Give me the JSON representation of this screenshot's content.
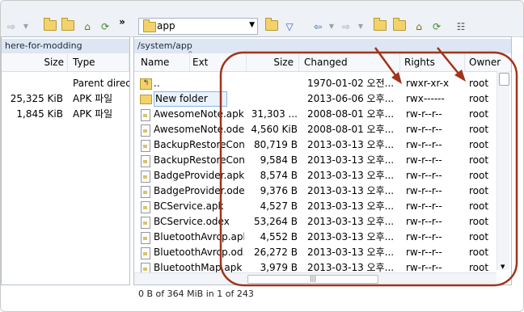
{
  "toolbar": {
    "overflow_label": "»",
    "combo_value": "app"
  },
  "left_panel": {
    "path": "here-for-modding",
    "columns": [
      "Size",
      "Type"
    ],
    "rows": [
      {
        "size": "",
        "type": "Parent direct"
      },
      {
        "size": "25,325 KiB",
        "type": "APK 파일"
      },
      {
        "size": "1,845 KiB",
        "type": "APK 파일"
      }
    ]
  },
  "right_panel": {
    "path": "/system/app",
    "columns": {
      "name": "Name",
      "ext": "Ext",
      "size": "Size",
      "changed": "Changed",
      "rights": "Rights",
      "owner": "Owner"
    },
    "rows": [
      {
        "name": "..",
        "size": "",
        "changed": "1970-01-02 오전...",
        "rights": "rwxr-xr-x",
        "owner": "root",
        "icon": "parent-dir-icon"
      },
      {
        "name": "New folder",
        "size": "",
        "changed": "2013-06-06 오후...",
        "rights": "rwx------",
        "owner": "root",
        "icon": "folder-icon"
      },
      {
        "name": "AwesomeNote.apk",
        "size": "31,303 ...",
        "changed": "2008-08-01 오후...",
        "rights": "rw-r--r--",
        "owner": "root",
        "icon": "file-icon"
      },
      {
        "name": "AwesomeNote.odex",
        "size": "4,560 KiB",
        "changed": "2008-08-01 오후...",
        "rights": "rw-r--r--",
        "owner": "root",
        "icon": "file-icon"
      },
      {
        "name": "BackupRestoreCon...",
        "size": "80,719 B",
        "changed": "2013-03-13 오후...",
        "rights": "rw-r--r--",
        "owner": "root",
        "icon": "file-icon"
      },
      {
        "name": "BackupRestoreCon...",
        "size": "9,584 B",
        "changed": "2013-03-13 오후...",
        "rights": "rw-r--r--",
        "owner": "root",
        "icon": "file-icon"
      },
      {
        "name": "BadgeProvider.apk",
        "size": "8,574 B",
        "changed": "2013-03-13 오후...",
        "rights": "rw-r--r--",
        "owner": "root",
        "icon": "file-icon"
      },
      {
        "name": "BadgeProvider.odex",
        "size": "9,376 B",
        "changed": "2013-03-13 오후...",
        "rights": "rw-r--r--",
        "owner": "root",
        "icon": "file-icon"
      },
      {
        "name": "BCService.apk",
        "size": "4,527 B",
        "changed": "2013-03-13 오후...",
        "rights": "rw-r--r--",
        "owner": "root",
        "icon": "file-icon"
      },
      {
        "name": "BCService.odex",
        "size": "53,264 B",
        "changed": "2013-03-13 오후...",
        "rights": "rw-r--r--",
        "owner": "root",
        "icon": "file-icon"
      },
      {
        "name": "BluetoothAvrcp.apk",
        "size": "4,552 B",
        "changed": "2013-03-13 오후...",
        "rights": "rw-r--r--",
        "owner": "root",
        "icon": "file-icon"
      },
      {
        "name": "BluetoothAvrcp.od...",
        "size": "26,272 B",
        "changed": "2013-03-13 오후...",
        "rights": "rw-r--r--",
        "owner": "root",
        "icon": "file-icon"
      },
      {
        "name": "BluetoothMap.apk",
        "size": "3,979 B",
        "changed": "2013-03-13 오후...",
        "rights": "rw-r--r--",
        "owner": "root",
        "icon": "file-icon"
      }
    ],
    "status": "0 B of 364 MiB in 1 of 243"
  },
  "colors": {
    "annotation": "#a0341a",
    "header_bg": "#dde6f2",
    "selection": "#86b6e6"
  }
}
